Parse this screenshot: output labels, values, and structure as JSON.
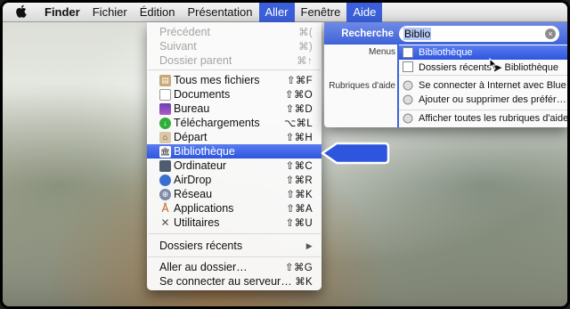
{
  "menubar": {
    "apple": "",
    "items": [
      "Finder",
      "Fichier",
      "Édition",
      "Présentation",
      "Aller",
      "Fenêtre",
      "Aide"
    ]
  },
  "aller_menu": {
    "items": [
      {
        "label": "Précédent",
        "shortcut": "⌘(",
        "disabled": true
      },
      {
        "label": "Suivant",
        "shortcut": "⌘)",
        "disabled": true
      },
      {
        "label": "Dossier parent",
        "shortcut": "⌘↑",
        "disabled": true
      },
      {
        "label": "Tous mes fichiers",
        "shortcut": "⇧⌘F",
        "icon": "all-files-icon"
      },
      {
        "label": "Documents",
        "shortcut": "⇧⌘O",
        "icon": "documents-icon"
      },
      {
        "label": "Bureau",
        "shortcut": "⇧⌘D",
        "icon": "desktop-icon"
      },
      {
        "label": "Téléchargements",
        "shortcut": "⌥⌘L",
        "icon": "downloads-icon"
      },
      {
        "label": "Départ",
        "shortcut": "⇧⌘H",
        "icon": "home-icon"
      },
      {
        "label": "Bibliothèque",
        "shortcut": "",
        "icon": "library-icon",
        "highlighted": true
      },
      {
        "label": "Ordinateur",
        "shortcut": "⇧⌘C",
        "icon": "computer-icon"
      },
      {
        "label": "AirDrop",
        "shortcut": "⇧⌘R",
        "icon": "airdrop-icon"
      },
      {
        "label": "Réseau",
        "shortcut": "⇧⌘K",
        "icon": "network-icon"
      },
      {
        "label": "Applications",
        "shortcut": "⇧⌘A",
        "icon": "applications-icon"
      },
      {
        "label": "Utilitaires",
        "shortcut": "⇧⌘U",
        "icon": "utilities-icon"
      },
      {
        "label": "Dossiers récents",
        "shortcut": "▶",
        "submenu": true
      },
      {
        "label": "Aller au dossier…",
        "shortcut": "⇧⌘G"
      },
      {
        "label": "Se connecter au serveur…",
        "shortcut": "⌘K"
      }
    ]
  },
  "help": {
    "search_label": "Recherche",
    "search_value": "Biblio",
    "clear": "×",
    "menus_label": "Menus",
    "topics_label": "Rubriques d'aide",
    "menu_results": [
      "Bibliothèque",
      "Dossiers récents ▶ Bibliothèque"
    ],
    "topic_results": [
      "Se connecter à Internet avec Blue…",
      "Ajouter ou supprimer des préfér…",
      "Afficher toutes les rubriques d'aide"
    ]
  },
  "colors": {
    "highlight": "#3b5fd8",
    "callout": "#2e55de"
  }
}
